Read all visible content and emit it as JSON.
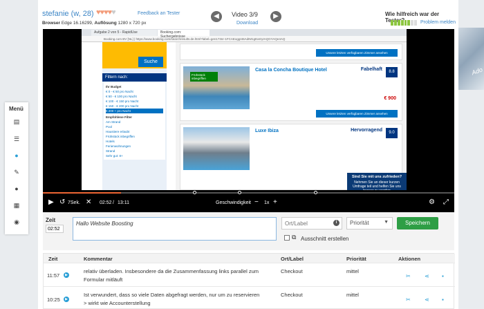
{
  "header": {
    "tester_name": "stefanie (w, 28)",
    "feedback_link": "Feedback an Tester",
    "browser_label": "Browser",
    "browser_value": "Edge 16.16299,",
    "resolution_label": "Auflösung",
    "resolution_value": "1280 x 720 px",
    "video_title": "Video 3/9",
    "download_link": "Download",
    "rating_question": "Wie hilfreich war der Tester?",
    "problem_link": "Problem melden",
    "hearts_filled": 4,
    "hearts_total": 5,
    "rating_level": 6,
    "rating_max": 8,
    "prev_icon": "arrow-left-icon",
    "next_icon": "arrow-right-icon"
  },
  "video": {
    "tab1": "Aufgabe 2 von 5 - RapidUse",
    "tab2": "Booking.com: Suchergebnisse",
    "url": "Booking.com BV [NL] | https://www.booking.com/searchresults.de.html?label=gen173nr-1FCAEoggI46AdIM1gEaGyIAQGYAQe4AQ",
    "suche": "Suche",
    "filter_title": "Filtern nach:",
    "budget_title": "Ihr Budget",
    "budget_options": [
      "€ 0 - € 50 pro Nacht",
      "€ 50 - € 100 pro Nacht",
      "€ 100 - € 150 pro Nacht",
      "€ 150 - € 200 pro Nacht",
      "€ 200 + pro Nacht"
    ],
    "empf_title": "Empfohlene Filter",
    "empf_options": [
      "Am Strand",
      "Pool",
      "Haustiere erlaubt",
      "Frühstück inbegriffen",
      "Hotels",
      "Ferienwohnungen",
      "Strand",
      "Sehr gut: 8+"
    ],
    "hotel1_name": "Casa la Concha Boutique Hotel",
    "hotel1_score_label": "Fabelhaft",
    "hotel1_score": "8.8",
    "hotel1_badge": "Frühstück inbegriffen",
    "hotel1_price": "€ 900",
    "hotel2_name": "Luxe Ibiza",
    "hotel2_score_label": "Hervorragend",
    "hotel2_score": "9.0",
    "avail_btn": "Unsere letzten verfügbaren Zimmer ansehen",
    "survey_title": "Sind Sie mit uns zufrieden?",
    "survey_text": "Nehmen Sie an dieser kurzen Umfrage teil und helfen Sie uns besser zu werden",
    "progress_fraction": 0.19,
    "time_current": "02:52",
    "time_total": "13:11",
    "speed_label": "Geschwindigkeit",
    "speed_value": "1x",
    "minus": "−",
    "plus": "+",
    "skip_label": "7Sek."
  },
  "menu": {
    "title": "Menü",
    "items": [
      "document-icon",
      "list-icon",
      "play-icon",
      "pencil-icon",
      "chat-icon",
      "film-icon",
      "eye-icon"
    ]
  },
  "form": {
    "zeit_label": "Zeit",
    "zeit_value": "02:52",
    "comment_value": "Hallo Website Boosting",
    "ortlabel_placeholder": "Ort/Label",
    "priority_value": "Priorität",
    "save_label": "Speichern",
    "ausschnitt_label": "Ausschnitt erstellen"
  },
  "table": {
    "headers": [
      "Zeit",
      "Kommentar",
      "Ort/Label",
      "Priorität",
      "Aktionen"
    ],
    "rows": [
      {
        "time": "11:57",
        "comment_line1": "relativ überladen. Insbesondere da die Zusammenfassung links parallel zum",
        "comment_line2": "Formular mitläuft",
        "ort": "Checkout",
        "prio": "mittel"
      },
      {
        "time": "10:25",
        "comment_line1": "Ist verwundert, dass so viele Daten abgefragt werden, nur um zu reservieren",
        "comment_line2": "> wirkt wie Accounterstellung",
        "ort": "Checkout",
        "prio": "mittel"
      }
    ]
  },
  "colors": {
    "accent": "#3d86c6",
    "save_green": "#2e9e45",
    "hearts": "#f39c7a",
    "rating_green": "#8cc63f"
  }
}
